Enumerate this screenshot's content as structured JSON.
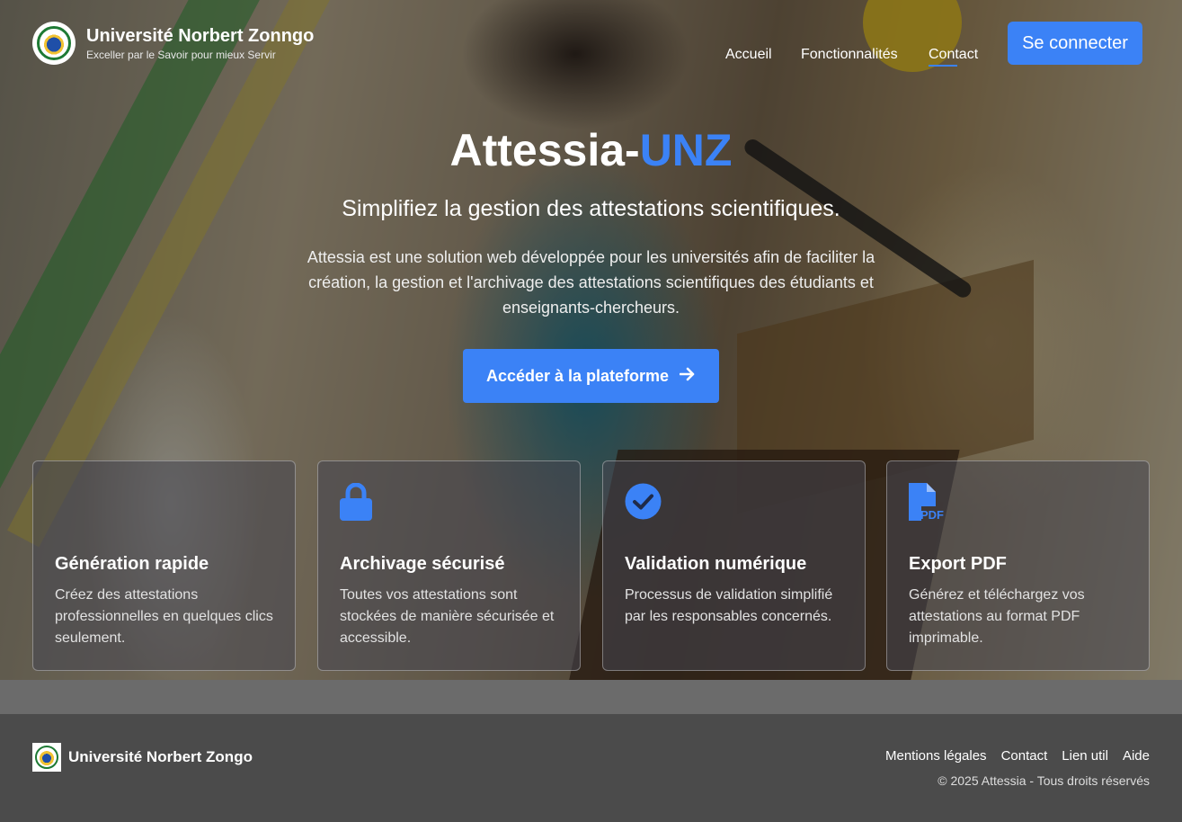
{
  "header": {
    "brand_title": "Université Norbert Zonngo",
    "brand_subtitle": "Exceller par le Savoir pour mieux Servir",
    "nav": [
      {
        "label": "Accueil"
      },
      {
        "label": "Fonctionnalités"
      },
      {
        "label": "Contact"
      }
    ],
    "login_label": "Se connecter"
  },
  "hero": {
    "title_main": "Attessia-",
    "title_accent": "UNZ",
    "subtitle": "Simplifiez la gestion des attestations scientifiques.",
    "description": "Attessia est une solution web développée pour les universités afin de faciliter la création, la gestion et l'archivage des attestations scientifiques des étudiants et enseignants-chercheurs.",
    "cta_label": "Accéder à la plateforme"
  },
  "features": [
    {
      "icon": "lightning-icon",
      "title": "Génération rapide",
      "text": "Créez des attestations professionnelles en quelques clics seulement."
    },
    {
      "icon": "lock-icon",
      "title": "Archivage sécurisé",
      "text": "Toutes vos attestations sont stockées de manière sécurisée et accessible."
    },
    {
      "icon": "check-circle-icon",
      "title": "Validation numérique",
      "text": "Processus de validation simplifié par les responsables concernés."
    },
    {
      "icon": "pdf-file-icon",
      "title": "Export PDF",
      "text": "Générez et téléchargez vos attestations au format PDF imprimable."
    }
  ],
  "footer": {
    "brand_name": "Université Norbert Zongo",
    "links": [
      {
        "label": "Mentions légales"
      },
      {
        "label": "Contact"
      },
      {
        "label": "Lien util"
      },
      {
        "label": "Aide"
      }
    ],
    "copyright": "© 2025 Attessia - Tous droits réservés"
  },
  "colors": {
    "accent": "#3b82f6",
    "footer_bg": "#4b4b4b",
    "strip_bg": "#6b6b6b"
  }
}
